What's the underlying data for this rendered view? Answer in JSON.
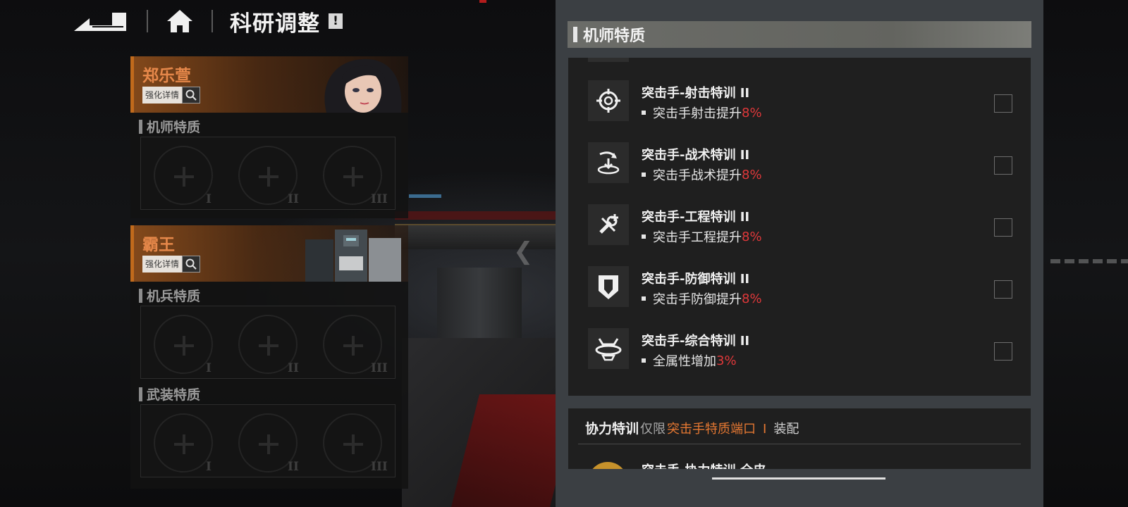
{
  "header": {
    "title": "科研调整",
    "alert": "!"
  },
  "left": {
    "pilot": {
      "name": "郑乐萱",
      "detail_label": "强化详情",
      "section": "机师特质",
      "slot_numerals": [
        "I",
        "II",
        "III"
      ]
    },
    "mech": {
      "name": "霸王",
      "detail_label": "强化详情",
      "section_a": "机兵特质",
      "section_b": "武装特质",
      "slot_numerals": [
        "I",
        "II",
        "III"
      ]
    }
  },
  "right": {
    "header": "机师特质",
    "traits": [
      {
        "title": "突击手-射击特训 II",
        "desc": "突击手射击提升",
        "value": "8%",
        "icon": "crosshair-icon"
      },
      {
        "title": "突击手-战术特训 II",
        "desc": "突击手战术提升",
        "value": "8%",
        "icon": "tactics-icon"
      },
      {
        "title": "突击手-工程特训 II",
        "desc": "突击手工程提升",
        "value": "8%",
        "icon": "wrench-icon"
      },
      {
        "title": "突击手-防御特训 II",
        "desc": "突击手防御提升",
        "value": "8%",
        "icon": "shield-icon"
      },
      {
        "title": "突击手-综合特训 II",
        "desc": "全属性增加",
        "value": "3%",
        "icon": "orbit-icon"
      }
    ],
    "coop": {
      "title": "协力特训",
      "limit": "仅限",
      "port": "突击手特质端口",
      "sep": "I",
      "equip": "装配",
      "peek_title": "突击手-协力特训·全皮"
    }
  },
  "colors": {
    "accent_orange": "#e67832",
    "value_red": "#e0383a",
    "panel_bg": "#1f1f1f"
  }
}
